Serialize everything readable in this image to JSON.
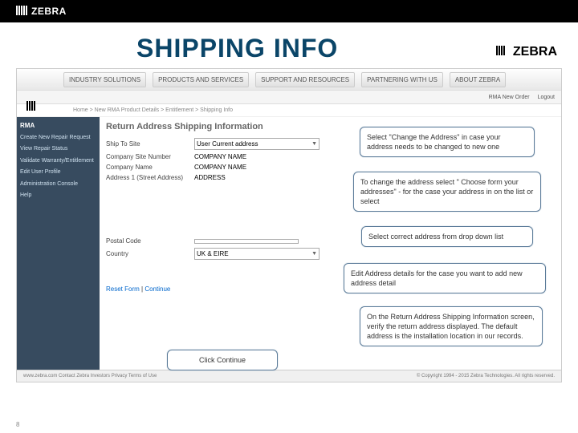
{
  "header": {
    "brand": "ZEBRA",
    "title": "SHIPPING INFO"
  },
  "nav": [
    "INDUSTRY SOLUTIONS",
    "PRODUCTS AND SERVICES",
    "SUPPORT AND RESOURCES",
    "PARTNERING WITH US",
    "ABOUT ZEBRA"
  ],
  "infobar": {
    "a": "RMA New Order",
    "b": "Logout"
  },
  "breadcrumb": "Home > New RMA Product Details > Entitlement > Shipping Info",
  "sidebar": {
    "hd": "RMA",
    "items": [
      "Create New Repair Request",
      "View Repair Status",
      "Validate Warranty/Entitlement",
      "Edit User Profile",
      "Administration Console",
      "Help"
    ]
  },
  "main": {
    "title": "Return Address Shipping Information",
    "shipTo": {
      "label": "Ship To Site",
      "value": "User Current address"
    },
    "csn": {
      "label": "Company Site Number",
      "value": "COMPANY NAME"
    },
    "cname": {
      "label": "Company Name",
      "value": "COMPANY NAME"
    },
    "addr1": {
      "label": "Address 1 (Street Address)",
      "value": "ADDRESS"
    },
    "postal": {
      "label": "Postal Code",
      "value": ""
    },
    "country": {
      "label": "Country",
      "value": "UK & EIRE"
    },
    "reset": "Reset Form",
    "cont": "Continue"
  },
  "callouts": {
    "c1": "Select \"Change the Address\" in case your address needs to be changed to new one",
    "c2": "To change the address select \" Choose form your addresses\"  - for the case your address in on the list or select",
    "c3": "Select  correct  address from drop down list",
    "c4": "Edit Address details for the case you want to add new address detail",
    "c5": "On the Return Address Shipping Information screen, verify the return address displayed. The default address is the installation location in our records.",
    "c6": "Click  Continue"
  },
  "footer": {
    "left": "www.zebra.com   Contact Zebra   Investors   Privacy   Terms of Use",
    "right": "© Copyright 1994 - 2015 Zebra Technologies. All rights reserved."
  },
  "pagenum": "8"
}
